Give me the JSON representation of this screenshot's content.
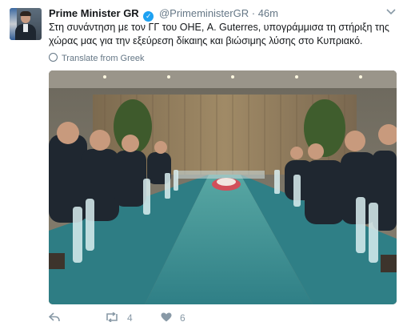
{
  "tweet": {
    "author_name": "Prime Minister GR",
    "verified_icon": "verified-badge-icon",
    "handle": "@PrimeministerGR",
    "separator": "·",
    "time": "46m",
    "text_line1": "Στη συνάντηση με τον ΓΓ του ΟΗΕ, A. Guterres, υπογράμμισα τη στήριξη της",
    "text_line2": "χώρας μας για την εξεύρεση δίκαιης και βιώσιμης λύσης στο Κυπριακό.",
    "translate_label": "Translate from Greek",
    "media_description_icon": "photo-meeting-icon",
    "actions": {
      "reply_icon": "reply-icon",
      "retweet_icon": "retweet-icon",
      "retweet_count": "4",
      "like_icon": "heart-icon",
      "like_count": "6"
    },
    "colors": {
      "link_blue": "#1da1f2",
      "secondary_text": "#657786",
      "icon_gray": "#8899a6"
    }
  }
}
